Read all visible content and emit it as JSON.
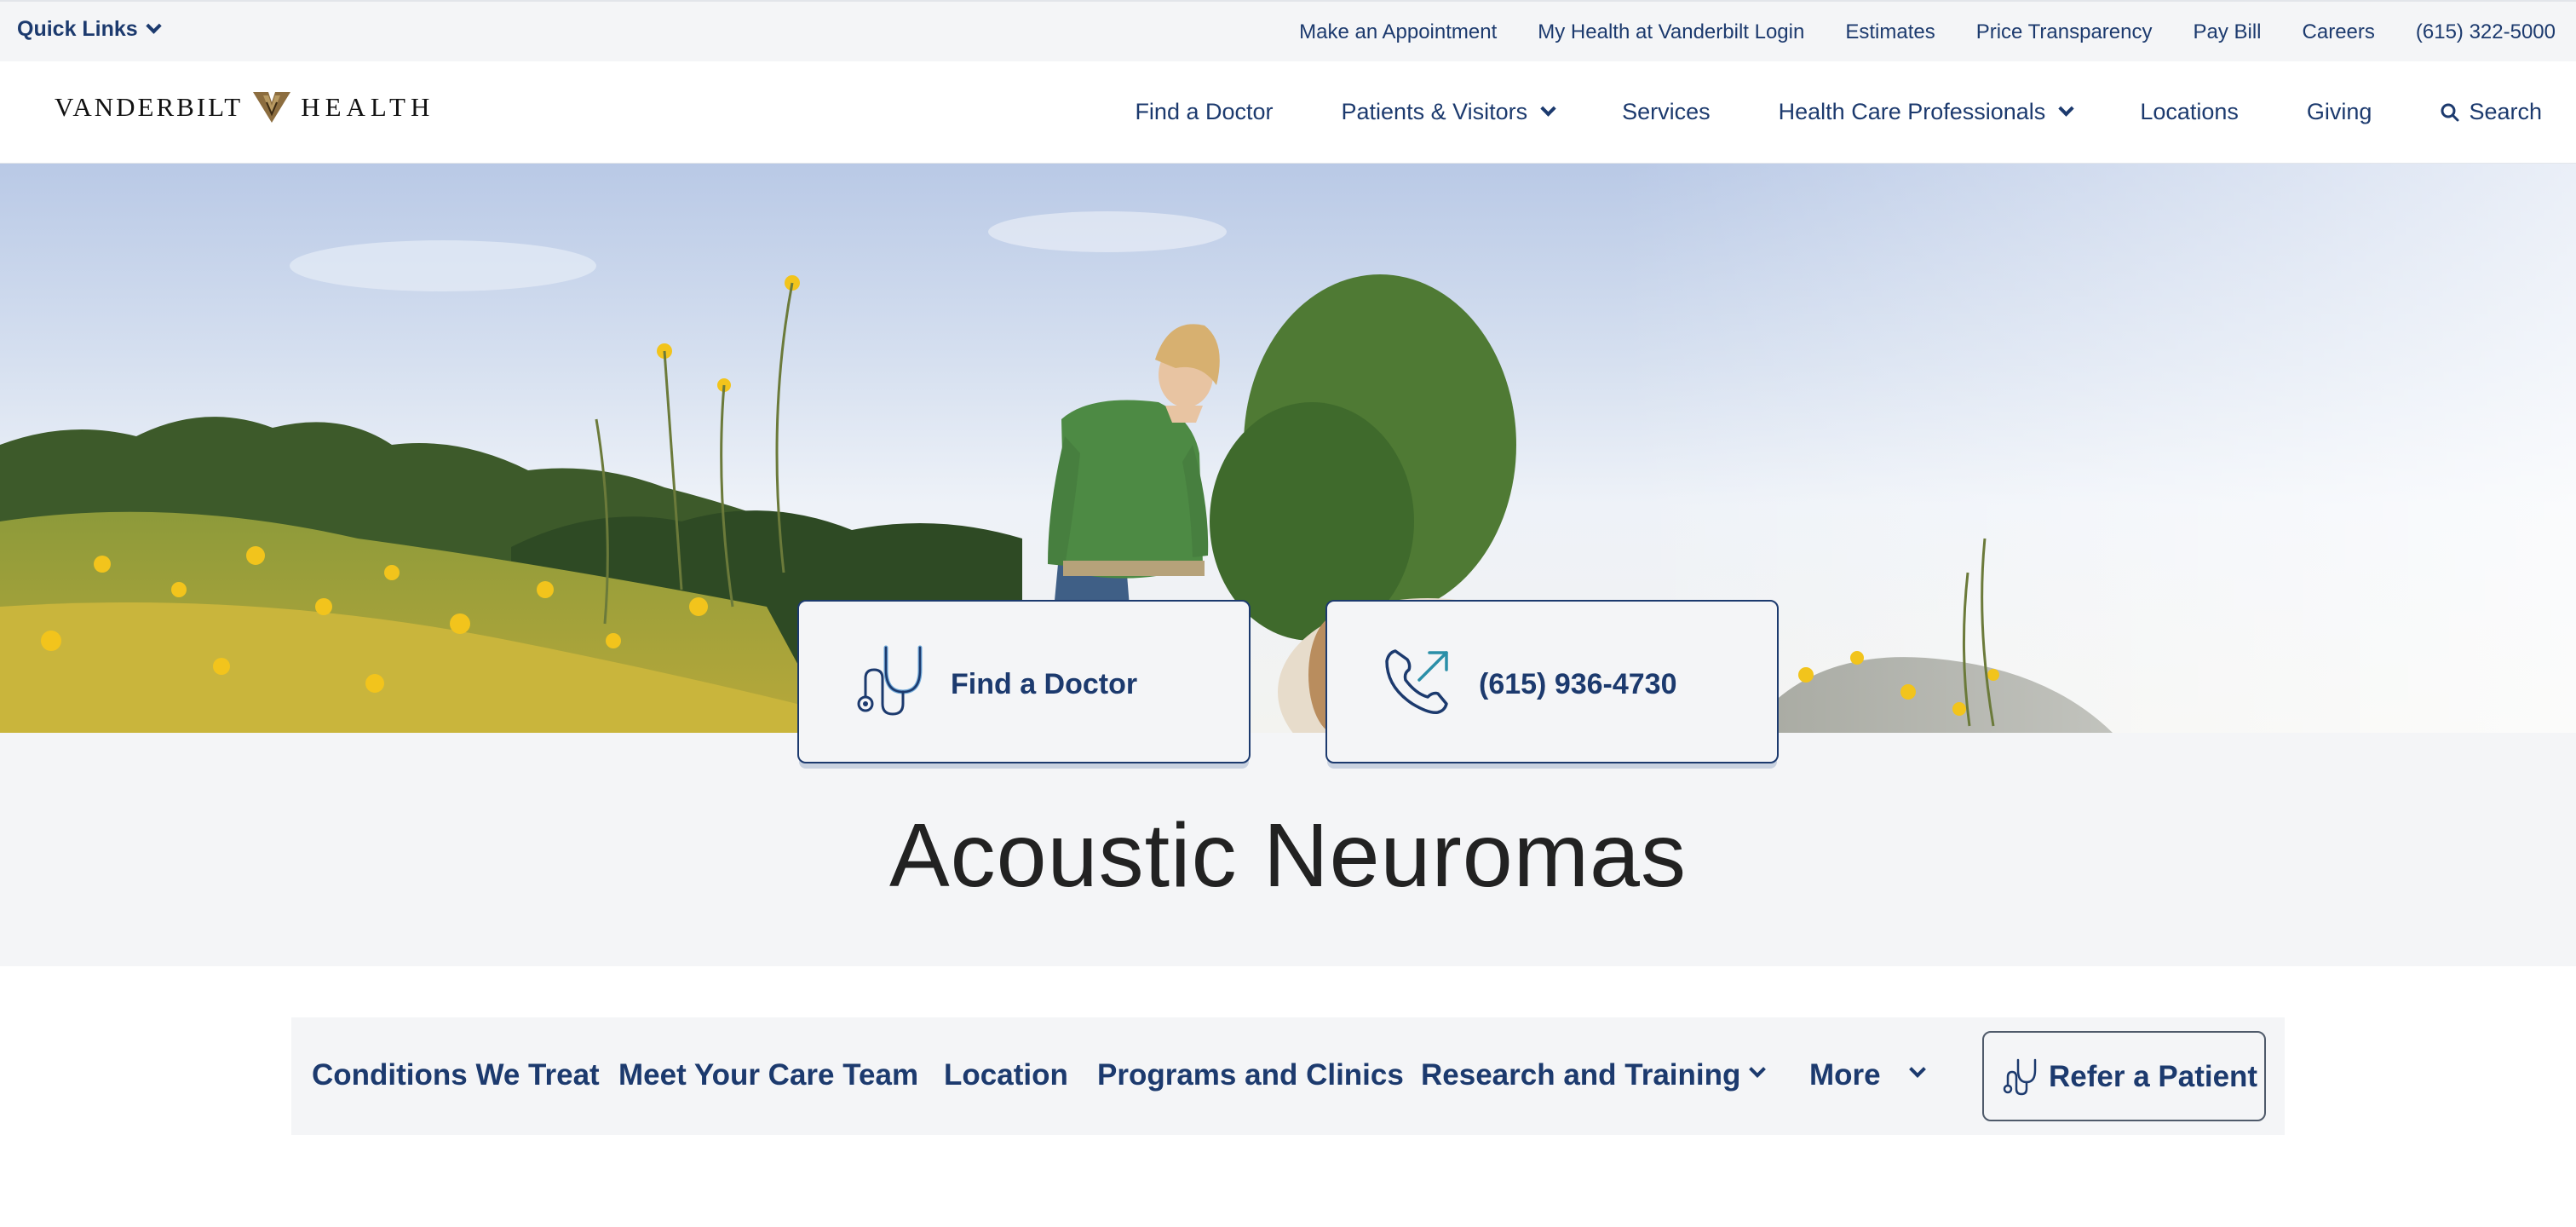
{
  "utility_bar": {
    "quick_links": "Quick Links",
    "links": [
      "Make an Appointment",
      "My Health at Vanderbilt Login",
      "Estimates",
      "Price Transparency",
      "Pay Bill",
      "Careers",
      "(615) 322-5000"
    ]
  },
  "header": {
    "logo_left": "VANDERBILT",
    "logo_right": "HEALTH",
    "nav": {
      "find_doctor": "Find a Doctor",
      "patients_visitors": "Patients & Visitors",
      "services": "Services",
      "health_care_professionals": "Health Care Professionals",
      "locations": "Locations",
      "giving": "Giving",
      "search": "Search"
    }
  },
  "hero": {
    "cta_doctor": "Find a Doctor",
    "cta_phone": "(615) 936-4730"
  },
  "page": {
    "title": "Acoustic Neuromas"
  },
  "section_nav": {
    "conditions": "Conditions We Treat",
    "care_team": "Meet Your Care Team",
    "location": "Location",
    "programs": "Programs and Clinics",
    "research": "Research and Training",
    "more": "More",
    "refer": "Refer a Patient"
  },
  "colors": {
    "brand_navy": "#1c3a6e",
    "band_gray": "#f4f5f7",
    "logo_gold": "#8c6d3f"
  },
  "icons": [
    "chevron-down-icon",
    "vanderbilt-v-icon",
    "search-icon",
    "stethoscope-icon",
    "phone-outgoing-icon"
  ]
}
